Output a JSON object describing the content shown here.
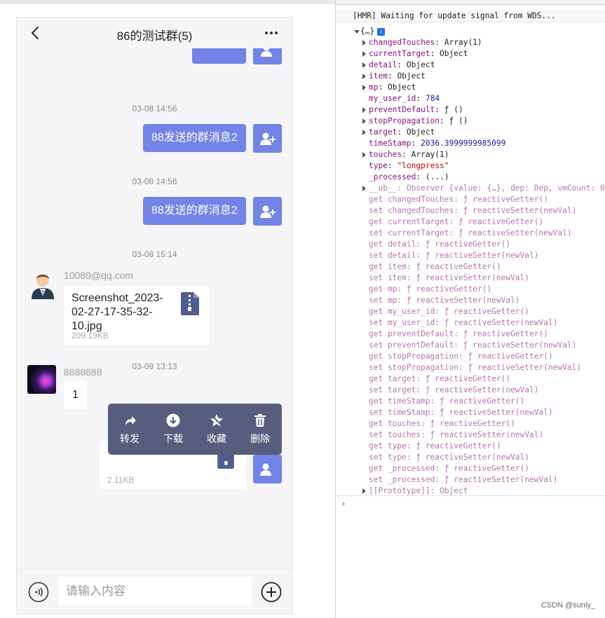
{
  "chat": {
    "title": "86的测试群(5)",
    "messages": {
      "t1": "03-08 14:56",
      "m1": "88发送的群消息2",
      "t2": "03-08 14:56",
      "m2": "88发送的群消息2",
      "t3": "03-08 15:14",
      "sender1": "10089@qq.com",
      "file1_name": "Screenshot_2023-02-27-17-35-32-10.jpg",
      "file1_size": "209.19KB",
      "t4": "03-09 13:13",
      "sender2": "8888888",
      "text2": "1",
      "file2_size": "2.11KB"
    },
    "context_menu": [
      "转发",
      "下载",
      "收藏",
      "删除"
    ],
    "input_placeholder": "请输入内容"
  },
  "console": {
    "hmr": "[HMR] Waiting for update signal from WDS...",
    "root": "{…}",
    "props": [
      {
        "expand": true,
        "key": "changedTouches",
        "val": "Array(1)",
        "cls": "v-obj"
      },
      {
        "expand": true,
        "key": "currentTarget",
        "val": "Object",
        "cls": "v-obj"
      },
      {
        "expand": true,
        "key": "detail",
        "val": "Object",
        "cls": "v-obj"
      },
      {
        "expand": true,
        "key": "item",
        "val": "Object",
        "cls": "v-obj"
      },
      {
        "expand": true,
        "key": "mp",
        "val": "Object",
        "cls": "v-obj"
      },
      {
        "expand": false,
        "key": "my_user_id",
        "val": "784",
        "cls": "v-num"
      },
      {
        "expand": true,
        "key": "preventDefault",
        "val": "ƒ ()",
        "cls": "v-obj"
      },
      {
        "expand": true,
        "key": "stopPropagation",
        "val": "ƒ ()",
        "cls": "v-obj"
      },
      {
        "expand": true,
        "key": "target",
        "val": "Object",
        "cls": "v-obj"
      },
      {
        "expand": false,
        "key": "timeStamp",
        "val": "2036.3999999985099",
        "cls": "v-num"
      },
      {
        "expand": true,
        "key": "touches",
        "val": "Array(1)",
        "cls": "v-obj"
      },
      {
        "expand": false,
        "key": "type",
        "val": "\"longpress\"",
        "cls": "v-str"
      },
      {
        "expand": false,
        "key": "_processed",
        "val": "(...)",
        "cls": "v-obj"
      }
    ],
    "ob_line": "__ob__: Observer {value: {…}, dep: Dep, vmCount: 0}",
    "accessors": [
      "get changedTouches: ƒ reactiveGetter()",
      "set changedTouches: ƒ reactiveSetter(newVal)",
      "get currentTarget: ƒ reactiveGetter()",
      "set currentTarget: ƒ reactiveSetter(newVal)",
      "get detail: ƒ reactiveGetter()",
      "set detail: ƒ reactiveSetter(newVal)",
      "get item: ƒ reactiveGetter()",
      "set item: ƒ reactiveSetter(newVal)",
      "get mp: ƒ reactiveGetter()",
      "set mp: ƒ reactiveSetter(newVal)",
      "get my_user_id: ƒ reactiveGetter()",
      "set my_user_id: ƒ reactiveSetter(newVal)",
      "get preventDefault: ƒ reactiveGetter()",
      "set preventDefault: ƒ reactiveSetter(newVal)",
      "get stopPropagation: ƒ reactiveGetter()",
      "set stopPropagation: ƒ reactiveSetter(newVal)",
      "get target: ƒ reactiveGetter()",
      "set target: ƒ reactiveSetter(newVal)",
      "get timeStamp: ƒ reactiveGetter()",
      "set timeStamp: ƒ reactiveSetter(newVal)",
      "get touches: ƒ reactiveGetter()",
      "set touches: ƒ reactiveSetter(newVal)",
      "get type: ƒ reactiveGetter()",
      "set type: ƒ reactiveSetter(newVal)",
      "get _processed: ƒ reactiveGetter()",
      "set _processed: ƒ reactiveSetter(newVal)"
    ],
    "proto_line": "[[Prototype]]: Object",
    "prompt": "›"
  },
  "watermark": "CSDN @sunly_",
  "colors": {
    "accent": "#7284e8",
    "menu": "#595d7d",
    "console_key": "#881280"
  }
}
